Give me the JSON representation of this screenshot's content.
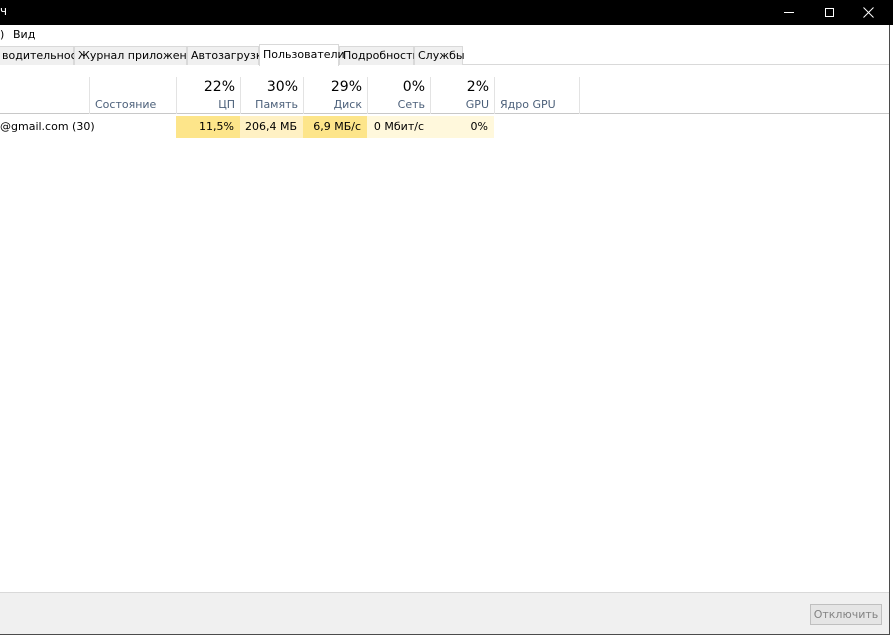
{
  "window": {
    "title_fragment": "ч",
    "controls": {
      "minimize": "minimize-icon",
      "maximize": "maximize-icon",
      "close": "close-icon"
    }
  },
  "menu": {
    "left_fragment": ")",
    "view": "Вид"
  },
  "tabs": [
    {
      "label": "водительность",
      "active": false
    },
    {
      "label": "Журнал приложений",
      "active": false
    },
    {
      "label": "Автозагрузка",
      "active": false
    },
    {
      "label": "Пользователи",
      "active": true
    },
    {
      "label": "Подробности",
      "active": false
    },
    {
      "label": "Службы",
      "active": false
    }
  ],
  "columns": {
    "status": {
      "label": "Состояние"
    },
    "cpu": {
      "percent": "22%",
      "label": "ЦП"
    },
    "memory": {
      "percent": "30%",
      "label": "Память"
    },
    "disk": {
      "percent": "29%",
      "label": "Диск"
    },
    "network": {
      "percent": "0%",
      "label": "Сеть"
    },
    "gpu": {
      "percent": "2%",
      "label": "GPU"
    },
    "gpu_engine": {
      "label": "Ядро GPU"
    }
  },
  "rows": [
    {
      "user": "@gmail.com (30)",
      "status": "",
      "cpu": "11,5%",
      "memory": "206,4 МБ",
      "disk": "6,9 МБ/с",
      "network": "0 Мбит/с",
      "gpu": "0%",
      "gpu_engine": ""
    }
  ],
  "footer": {
    "disconnect_label": "Отключить"
  },
  "colors": {
    "cpu_cell": "#fde58a",
    "memory_cell": "#fff1c4",
    "disk_cell": "#fde58a",
    "network_cell": "#fff8dc",
    "gpu_cell": "#fff8dc",
    "titlebar": "#000000"
  }
}
